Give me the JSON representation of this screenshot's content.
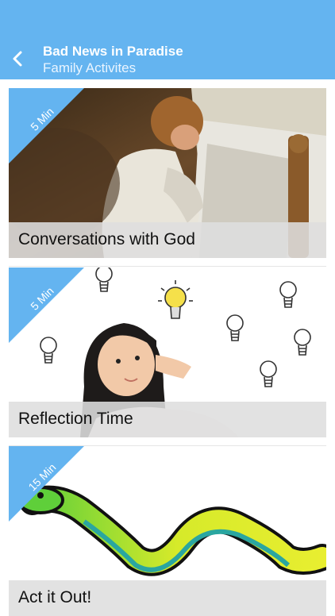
{
  "header": {
    "title": "Bad News in Paradise",
    "subtitle": "Family Activites",
    "back_icon": "chevron-left-icon",
    "background": "#64b4f0"
  },
  "cards": [
    {
      "duration": "5 Min",
      "title": "Conversations with God",
      "image": "child-praying-by-bed-painting"
    },
    {
      "duration": "5 Min",
      "title": "Reflection Time",
      "image": "girl-thinking-with-lightbulbs"
    },
    {
      "duration": "15 Min",
      "title": "Act it Out!",
      "image": "green-snake-illustration"
    }
  ]
}
